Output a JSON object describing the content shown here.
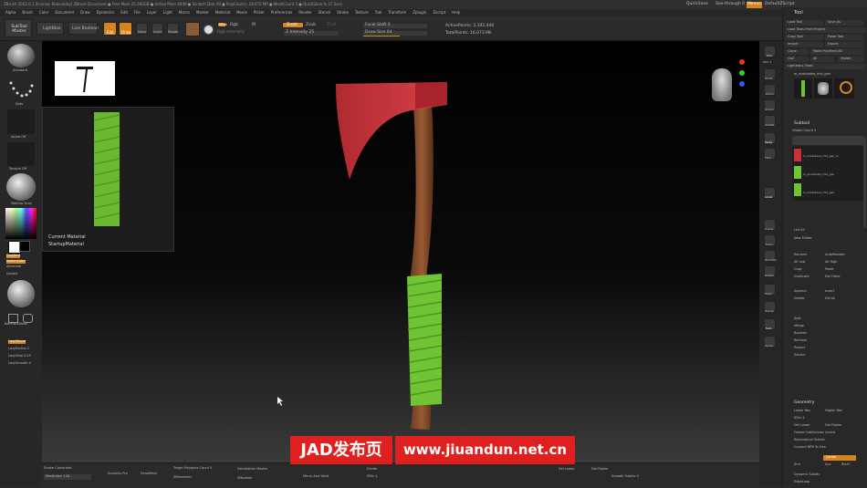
{
  "app": {
    "title": "ZBrush 2022.0.1 [license: Koloveisky]   ZBrush Document   ● Free Mem 25.566GB ● Active Mem 8449 ● Scratch Disk 49 ● PolyCount> 18.072 MP ● MeshCount 3 ● QuickSave In 27 Secs",
    "quicksave": "QuickSave",
    "see_through": "See-through  0",
    "menus_btn": "Menus",
    "default_script": "DefaultZScript"
  },
  "menubar": {
    "items": [
      "Alpha",
      "Brush",
      "Color",
      "Document",
      "Draw",
      "Dynamics",
      "Edit",
      "File",
      "Layer",
      "Light",
      "Macro",
      "Marker",
      "Material",
      "Movie",
      "Picker",
      "Preferences",
      "Render",
      "Stencil",
      "Stroke",
      "Texture",
      "Tool",
      "Transform",
      "Zplugin",
      "Zscript",
      "Help"
    ]
  },
  "toolshelf": {
    "subtool_master": "SubTool Master",
    "lightbox": "LightBox",
    "live_boolean": "Live Boolean",
    "edit": "Edit",
    "draw": "Draw",
    "move": "Move",
    "scale": "Scale",
    "rotate": "Rotate",
    "mrgb": "Mrgb",
    "rgb": "Rgb",
    "m": "M",
    "zadd": "Zadd",
    "zsub": "Zsub",
    "zcut": "Zcut",
    "rgb_intensity": "Rgb Intensity",
    "z_intensity": "Z Intensity 25",
    "focal_shift": "Focal Shift 0",
    "draw_size": "Draw Size 64",
    "active_points": "ActivePoints: 3,192,446",
    "total_points": "TotalPoints: 16,073 Mil"
  },
  "leftshelf": {
    "brush_label": "Standard",
    "stroke_label": "Dots",
    "alpha_label": "Alpha Off",
    "texture_label": "Texture Off",
    "material_label": "MatCap Gray",
    "gradient": "Gradient",
    "switch_color": "SwitchColor",
    "alternate": "Alternate",
    "double": "Double",
    "backface_mask": "BackfaceMask",
    "lazy_mouse": "LazyMouse",
    "lazy_radius": "LazyRadius 1",
    "lazy_step": "LazyStep 0.25",
    "lazy_smooth": "LazySmooth 4"
  },
  "viewport": {
    "popup_title": "Current Material",
    "popup_subtitle": "StartupMaterial"
  },
  "bottombar": {
    "stroke_label": "Stroke Constraint",
    "resolution": "Resolution 128",
    "sculptris": "Sculptris Pro",
    "dynamesh": "DynaMesh",
    "target_polygons": "Target Polygons Count 5",
    "zremesher": "ZRemesher",
    "decimation": "Decimation Master",
    "zmodeler": "ZModeler",
    "mirror_weld": "Mirror And Weld",
    "divide": "Divide",
    "del_lower": "Del Lower",
    "del_higher": "Del Higher",
    "sdiv": "SDiv 4",
    "smooth": "Smooth Subdiv 0"
  },
  "rightshelf": {
    "bpr": "BPR",
    "spix": "SPix 3",
    "scroll": "Scroll",
    "zoom": "Zoom",
    "actual": "Actual",
    "aahalf": "AAHalf",
    "persp": "Persp",
    "floor": "Floor",
    "local": "Local",
    "frame": "Frame",
    "move": "Move",
    "zoom3d": "Zoom3D",
    "rotate": "Rotate",
    "polyf": "PolyF",
    "transp": "Transp",
    "solo": "Solo",
    "xpose": "Xpose"
  },
  "toolpalette": {
    "title": "Tool",
    "load_tool": "Load Tool",
    "save_as": "Save As",
    "load_from_project": "Load Tools From Project",
    "copy_tool": "Copy Tool",
    "paste_tool": "Paste Tool",
    "import": "Import",
    "export": "Export",
    "clone": "Clone",
    "make_polymesh": "Make PolyMesh3D",
    "goz": "GoZ",
    "all": "All",
    "visible": "Visible",
    "lightbox_tools": "Lightbox ▸ Tools",
    "tool_name": "m_axebladea_mid_geo",
    "subtool_header": "Subtool",
    "visible_count": "Visible Count 3",
    "subtools": [
      "m_axebladea_mid_geo_m",
      "m_axehandle_mid_geo",
      "m_axebladea_mid_geo"
    ],
    "list_all": "List All",
    "new_folder": "New Folder",
    "rename": "Rename",
    "autoreorder": "AutoReorder",
    "all_low": "All Low",
    "all_high": "All High",
    "copy": "Copy",
    "paste": "Paste",
    "duplicate": "Duplicate",
    "append": "Append",
    "insert": "Insert",
    "delete": "Delete",
    "del_other": "Del Other",
    "del_all": "Del All",
    "split": "Split",
    "merge": "Merge",
    "boolean": "Boolean",
    "remesh": "Remesh",
    "project": "Project",
    "extract": "Extract",
    "geometry": "Geometry",
    "lower_res": "Lower Res",
    "higher_res": "Higher Res",
    "sdiv": "SDiv 4",
    "del_lower": "Del Lower",
    "del_higher": "Del Higher",
    "freeze_subdiv": "Freeze SubDivision Levels",
    "reconstruct": "Reconstruct Subdiv",
    "convert_bpr": "Convert BPR To Geo",
    "divide": "Divide",
    "smt": "Smt",
    "suv": "Suv",
    "reuv": "ReUV",
    "dynamic_subdiv": "Dynamic Subdiv",
    "edgeloop": "EdgeLoop"
  },
  "banner": {
    "left": "JAD发布页",
    "right": "www.jiuandun.net.cn"
  },
  "colors": {
    "accent": "#d8841c",
    "blade": "#c8313a",
    "handle": "#7a4628",
    "wrap": "#7cd43a"
  }
}
